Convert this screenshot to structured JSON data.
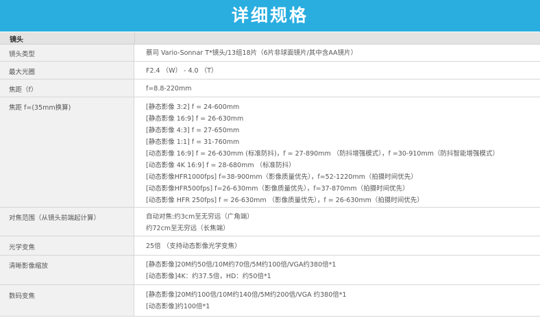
{
  "banner": {
    "title": "详细规格"
  },
  "section": {
    "title": "镜头"
  },
  "rows": [
    {
      "label": "镜头类型",
      "lines": [
        "蔡司 Vario-Sonnar T*镜头/13组18片（6片非球面镜片/其中含AA镜片）"
      ]
    },
    {
      "label": "最大光圈",
      "lines": [
        "F2.4 （W） - 4.0 （T）"
      ]
    },
    {
      "label": "焦距（f）",
      "lines": [
        "f=8.8-220mm"
      ]
    },
    {
      "label": "焦距 f=(35mm换算)",
      "lines": [
        "[静态影像 3:2] f = 24-600mm",
        "[静态影像 16:9] f = 26-630mm",
        "[静态影像 4:3] f = 27-650mm",
        "[静态影像 1:1] f = 31-760mm",
        "[动态影像 16:9] f = 26-630mm (标准防抖)，f = 27-890mm （防抖增强模式），f =30-910mm（防抖智能增强模式）",
        "[动态影像 4K 16:9] f = 28-680mm （标准防抖）",
        "[动态影像HFR1000fps] f=38-900mm（影像质量优先），f=52-1220mm（拍摄时间优先）",
        "[动态影像HFR500fps] f=26-630mm（影像质量优先），f=37-870mm（拍摄时间优先）",
        "[动态影像 HFR 250fps] f = 26-630mm （影像质量优先），f = 26-630mm（拍摄时间优先）"
      ]
    },
    {
      "label": "对焦范围（从镜头前端起计算）",
      "lines": [
        "自动对焦:约3cm至无穷远（广角端）",
        "约72cm至无穷远（长焦端）"
      ]
    },
    {
      "label": "光学变焦",
      "lines": [
        "25倍 （支持动态影像光学变焦）"
      ]
    },
    {
      "label": "清晰影像缩放",
      "lines": [
        "[静态影像]20M约50倍/10M约70倍/5M约100倍/VGA约380倍*1",
        "[动态影像]4K：约37.5倍，HD：约50倍*1"
      ]
    },
    {
      "label": "数码变焦",
      "lines": [
        "[静态影像]20M约100倍/10M约140倍/5M约200倍/VGA 约380倍*1",
        "[动态影像]约100倍*1"
      ]
    }
  ]
}
